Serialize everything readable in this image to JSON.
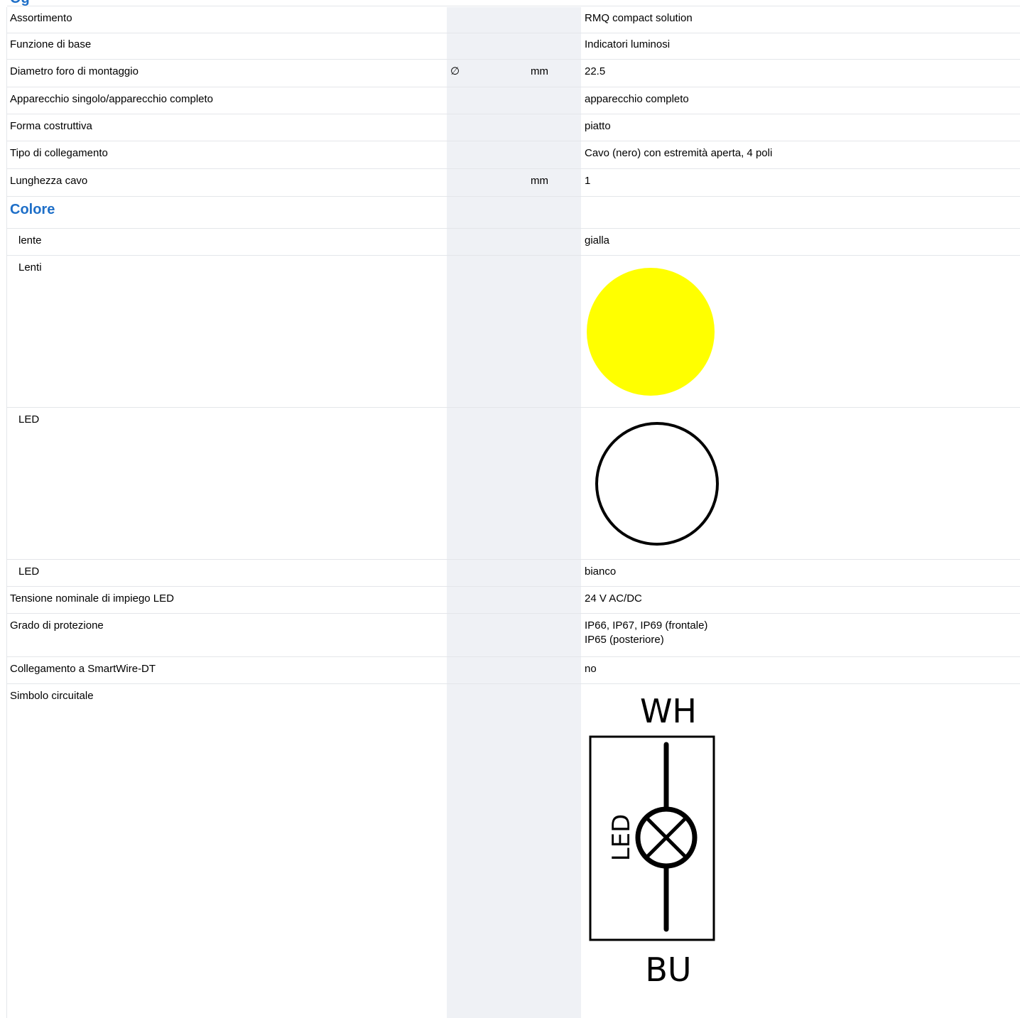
{
  "section_heading_partial": "Og",
  "rows": {
    "assortimento": {
      "label": "Assortimento",
      "value": "RMQ compact solution"
    },
    "funzione": {
      "label": "Funzione di base",
      "value": "Indicatori luminosi"
    },
    "diametro": {
      "label": "Diametro foro di montaggio",
      "symbol": "∅",
      "unit": "mm",
      "value": "22.5"
    },
    "apparecchio": {
      "label": "Apparecchio singolo/apparecchio completo",
      "value": "apparecchio completo"
    },
    "forma": {
      "label": "Forma costruttiva",
      "value": "piatto"
    },
    "tipo_collegamento": {
      "label": "Tipo di collegamento",
      "value": "Cavo (nero) con estremità aperta, 4 poli"
    },
    "lunghezza_cavo": {
      "label": "Lunghezza cavo",
      "unit": "mm",
      "value": "1"
    },
    "colore": {
      "label": "Colore"
    },
    "lente": {
      "label": "lente",
      "value": "gialla"
    },
    "lenti": {
      "label": "Lenti",
      "swatch_color": "#ffff00"
    },
    "led_swatch": {
      "label": "LED",
      "swatch_color": "#ffffff"
    },
    "led": {
      "label": "LED",
      "value": "bianco"
    },
    "tensione": {
      "label": "Tensione nominale di impiego LED",
      "value": "24 V AC/DC"
    },
    "grado": {
      "label": "Grado di protezione",
      "value_line1": "IP66, IP67, IP69 (frontale)",
      "value_line2": "IP65 (posteriore)"
    },
    "smartwire": {
      "label": "Collegamento a SmartWire-DT",
      "value": "no"
    },
    "simbolo": {
      "label": "Simbolo circuitale"
    }
  },
  "circuit_symbol": {
    "top_label": "WH",
    "bottom_label": "BU",
    "side_label": "LED",
    "icon": "lamp-symbol-icon"
  },
  "colors": {
    "heading_blue": "#1e6fc8",
    "column_gray": "#eff1f5",
    "lens_yellow": "#ffff00"
  }
}
